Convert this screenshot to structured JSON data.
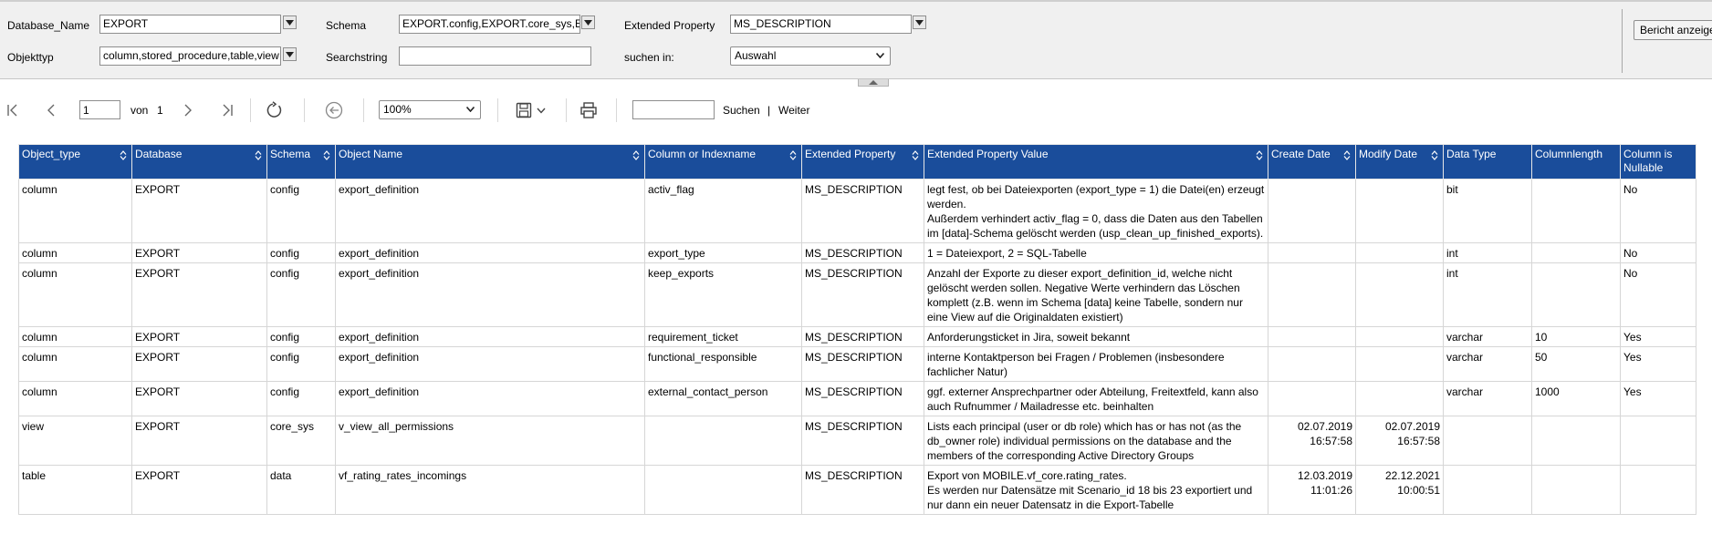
{
  "parameters": {
    "database_name": {
      "label": "Database_Name",
      "value": "EXPORT"
    },
    "schema": {
      "label": "Schema",
      "value": "EXPORT.config,EXPORT.core_sys,EXPORT.data"
    },
    "extended_property": {
      "label": "Extended Property",
      "value": "MS_DESCRIPTION"
    },
    "objekttyp": {
      "label": "Objekttyp",
      "value": "column,stored_procedure,table,view"
    },
    "searchstring": {
      "label": "Searchstring",
      "value": ""
    },
    "suchen_in": {
      "label": "suchen in:",
      "value": "Auswahl"
    },
    "view_report_button": "Bericht anzeigen"
  },
  "toolbar": {
    "page_current": "1",
    "page_of_label": "von",
    "page_total": "1",
    "zoom": "100%",
    "find_label": "Suchen",
    "find_separator": "|",
    "next_label": "Weiter"
  },
  "icons": {
    "first_page": "first-page-icon",
    "prev_page": "previous-page-icon",
    "next_page": "next-page-icon",
    "last_page": "last-page-icon",
    "refresh": "refresh-icon",
    "back": "back-icon",
    "export": "save-icon",
    "print": "print-icon",
    "sort": "sort-arrows-icon",
    "dropdown": "chevron-down-icon"
  },
  "colors": {
    "header_bg": "#1a4d9b",
    "header_text": "#ffffff",
    "param_bg": "#f0f0f0"
  },
  "table": {
    "columns": [
      "Object_type",
      "Database",
      "Schema",
      "Object Name",
      "Column or Indexname",
      "Extended Property",
      "Extended Property Value",
      "Create Date",
      "Modify Date",
      "Data Type",
      "Columnlength",
      "Column is Nullable"
    ],
    "rows": [
      [
        "column",
        "EXPORT",
        "config",
        "export_definition",
        "activ_flag",
        "MS_DESCRIPTION",
        "legt fest, ob bei Dateiexporten (export_type = 1) die Datei(en) erzeugt werden.\nAußerdem verhindert activ_flag = 0, dass die Daten aus den Tabellen im [data]-Schema gelöscht werden (usp_clean_up_finished_exports).",
        "",
        "",
        "bit",
        "",
        "No"
      ],
      [
        "column",
        "EXPORT",
        "config",
        "export_definition",
        "export_type",
        "MS_DESCRIPTION",
        "1 = Dateiexport, 2 = SQL-Tabelle",
        "",
        "",
        "int",
        "",
        "No"
      ],
      [
        "column",
        "EXPORT",
        "config",
        "export_definition",
        "keep_exports",
        "MS_DESCRIPTION",
        "Anzahl der Exporte zu dieser export_definition_id, welche nicht gelöscht werden sollen. Negative Werte verhindern das Löschen komplett (z.B. wenn im Schema [data] keine Tabelle, sondern nur eine View auf die Originaldaten existiert)",
        "",
        "",
        "int",
        "",
        "No"
      ],
      [
        "column",
        "EXPORT",
        "config",
        "export_definition",
        "requirement_ticket",
        "MS_DESCRIPTION",
        "Anforderungsticket in Jira, soweit bekannt",
        "",
        "",
        "varchar",
        "10",
        "Yes"
      ],
      [
        "column",
        "EXPORT",
        "config",
        "export_definition",
        "functional_responsible",
        "MS_DESCRIPTION",
        "interne Kontaktperson bei Fragen / Problemen (insbesondere fachlicher Natur)",
        "",
        "",
        "varchar",
        "50",
        "Yes"
      ],
      [
        "column",
        "EXPORT",
        "config",
        "export_definition",
        "external_contact_person",
        "MS_DESCRIPTION",
        "ggf. externer Ansprechpartner oder Abteilung, Freitextfeld, kann also auch Rufnummer / Mailadresse etc. beinhalten",
        "",
        "",
        "varchar",
        "1000",
        "Yes"
      ],
      [
        "view",
        "EXPORT",
        "core_sys",
        "v_view_all_permissions",
        "",
        "MS_DESCRIPTION",
        "Lists each principal (user or db role) which has or has not (as the db_owner role) individual permissions on the database and the members of the corresponding Active Directory Groups",
        "02.07.2019\n16:57:58",
        "02.07.2019\n16:57:58",
        "",
        "",
        ""
      ],
      [
        "table",
        "EXPORT",
        "data",
        "vf_rating_rates_incomings",
        "",
        "MS_DESCRIPTION",
        "Export von MOBILE.vf_core.rating_rates.\nEs werden nur Datensätze mit Scenario_id 18 bis 23 exportiert und nur dann ein neuer Datensatz in die Export-Tabelle",
        "12.03.2019\n11:01:26",
        "22.12.2021\n10:00:51",
        "",
        "",
        ""
      ]
    ]
  }
}
